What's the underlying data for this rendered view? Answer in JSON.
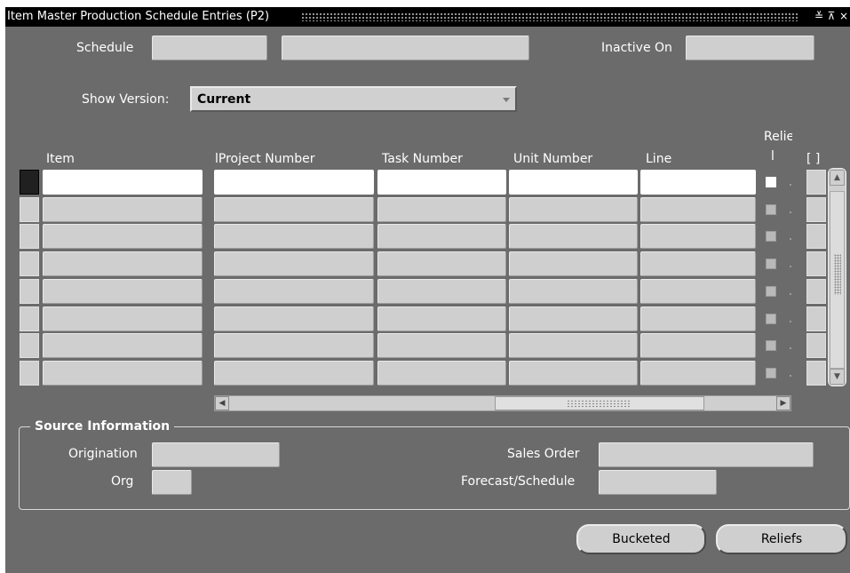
{
  "window": {
    "title": "Item Master Production Schedule Entries (P2)",
    "icons": [
      "minimize-icon",
      "maximize-icon",
      "close-icon"
    ],
    "minimize_glyph": "≚",
    "maximize_glyph": "⊼",
    "close_glyph": "×"
  },
  "header": {
    "schedule_label": "Schedule",
    "schedule_value": "",
    "schedule_desc_value": "",
    "inactive_on_label": "Inactive On",
    "inactive_on_value": "",
    "show_version_label": "Show Version:",
    "show_version_value": "Current"
  },
  "table": {
    "columns": {
      "item": "Item",
      "project_number": "lProject Number",
      "task_number": "Task Number",
      "unit_number": "Unit Number",
      "line": "Line",
      "relief_top": "Relie",
      "relief_bottom": "l",
      "bracket": "[ ]"
    },
    "rows": [
      {
        "item": "",
        "project_number": "",
        "task_number": "",
        "unit_number": "",
        "line": "",
        "relief": false,
        "current": true
      },
      {
        "item": "",
        "project_number": "",
        "task_number": "",
        "unit_number": "",
        "line": "",
        "relief": false,
        "current": false
      },
      {
        "item": "",
        "project_number": "",
        "task_number": "",
        "unit_number": "",
        "line": "",
        "relief": false,
        "current": false
      },
      {
        "item": "",
        "project_number": "",
        "task_number": "",
        "unit_number": "",
        "line": "",
        "relief": false,
        "current": false
      },
      {
        "item": "",
        "project_number": "",
        "task_number": "",
        "unit_number": "",
        "line": "",
        "relief": false,
        "current": false
      },
      {
        "item": "",
        "project_number": "",
        "task_number": "",
        "unit_number": "",
        "line": "",
        "relief": false,
        "current": false
      },
      {
        "item": "",
        "project_number": "",
        "task_number": "",
        "unit_number": "",
        "line": "",
        "relief": false,
        "current": false
      },
      {
        "item": "",
        "project_number": "",
        "task_number": "",
        "unit_number": "",
        "line": "",
        "relief": false,
        "current": false
      }
    ]
  },
  "source_information": {
    "title": "Source Information",
    "origination_label": "Origination",
    "origination_value": "",
    "org_label": "Org",
    "org_value": "",
    "sales_order_label": "Sales Order",
    "sales_order_value": "",
    "forecast_schedule_label": "Forecast/Schedule",
    "forecast_schedule_value": ""
  },
  "buttons": {
    "bucketed_label": "Bucketed",
    "reliefs_label": "Reliefs"
  },
  "colors": {
    "window_bg": "#6b6b6b",
    "titlebar_bg": "#000000",
    "field_bg": "#cfcfcf",
    "current_field_bg": "#ffffff"
  }
}
